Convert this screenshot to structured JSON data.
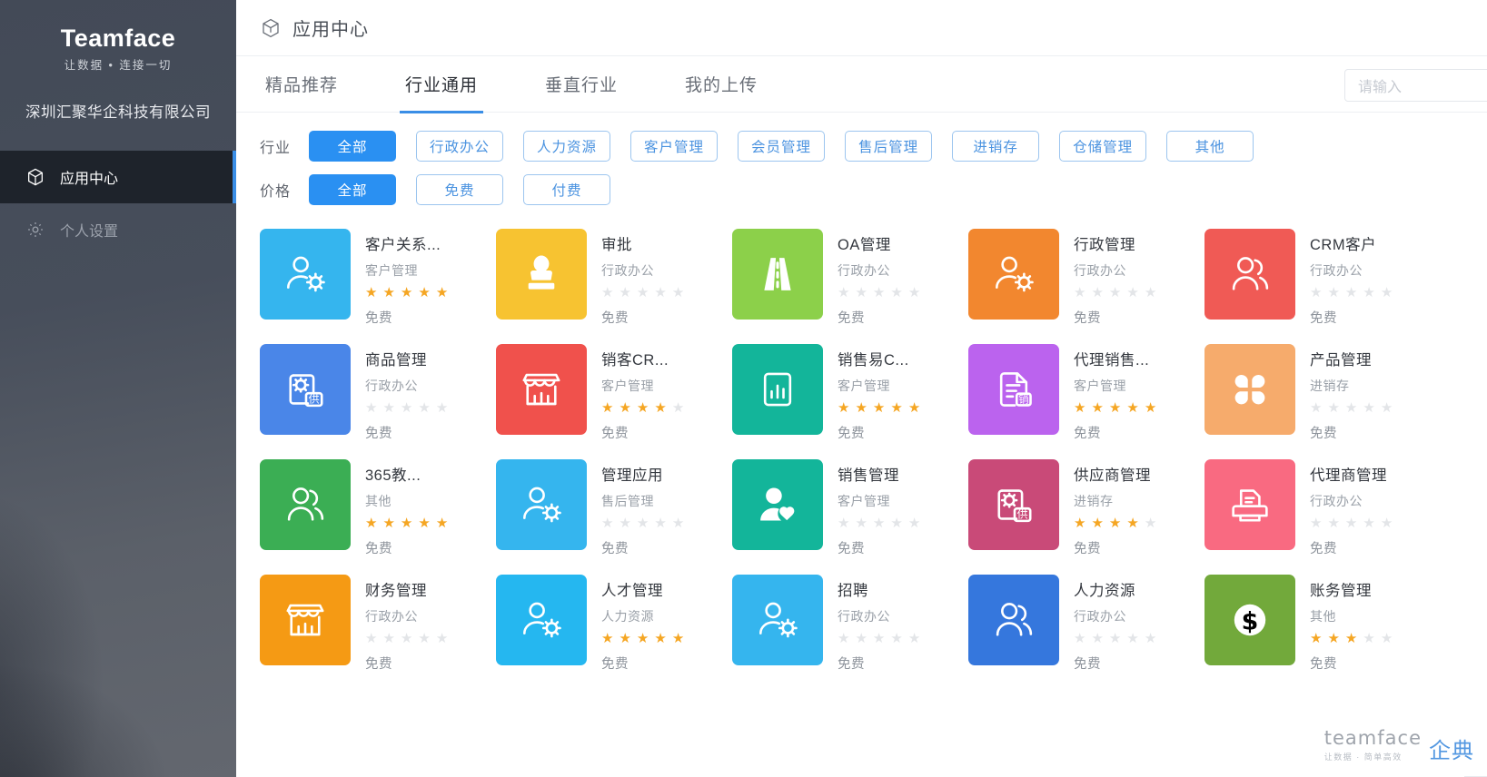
{
  "sidebar": {
    "logo": "Teamface",
    "slogan": "让数据 • 连接一切",
    "company": "深圳汇聚华企科技有限公司",
    "items": [
      {
        "label": "应用中心",
        "icon": "cube-icon",
        "active": true
      },
      {
        "label": "个人设置",
        "icon": "gear-icon",
        "active": false
      }
    ]
  },
  "header": {
    "title": "应用中心",
    "icon": "cube-icon"
  },
  "tabs": [
    {
      "label": "精品推荐",
      "active": false
    },
    {
      "label": "行业通用",
      "active": true
    },
    {
      "label": "垂直行业",
      "active": false
    },
    {
      "label": "我的上传",
      "active": false
    }
  ],
  "search": {
    "placeholder": "请输入",
    "value": ""
  },
  "filters": [
    {
      "label": "行业",
      "options": [
        {
          "label": "全部",
          "active": true
        },
        {
          "label": "行政办公",
          "active": false
        },
        {
          "label": "人力资源",
          "active": false
        },
        {
          "label": "客户管理",
          "active": false
        },
        {
          "label": "会员管理",
          "active": false
        },
        {
          "label": "售后管理",
          "active": false
        },
        {
          "label": "进销存",
          "active": false
        },
        {
          "label": "仓储管理",
          "active": false
        },
        {
          "label": "其他",
          "active": false
        }
      ]
    },
    {
      "label": "价格",
      "options": [
        {
          "label": "全部",
          "active": true
        },
        {
          "label": "免费",
          "active": false
        },
        {
          "label": "付费",
          "active": false
        }
      ]
    }
  ],
  "apps": [
    {
      "name": "客户关系...",
      "category": "客户管理",
      "stars": 5,
      "price": "免费",
      "color": "#35b5ee",
      "icon": "user-gear-icon"
    },
    {
      "name": "审批",
      "category": "行政办公",
      "stars": 0,
      "price": "免费",
      "color": "#f7c331",
      "icon": "stamp-icon"
    },
    {
      "name": "OA管理",
      "category": "行政办公",
      "stars": 0,
      "price": "免费",
      "color": "#8cd04a",
      "icon": "road-icon"
    },
    {
      "name": "行政管理",
      "category": "行政办公",
      "stars": 0,
      "price": "免费",
      "color": "#f2872f",
      "icon": "user-gear-icon"
    },
    {
      "name": "CRM客户",
      "category": "行政办公",
      "stars": 0,
      "price": "免费",
      "color": "#f05a55",
      "icon": "users-icon"
    },
    {
      "name": "商品管理",
      "category": "行政办公",
      "stars": 0,
      "price": "免费",
      "color": "#4a86e8",
      "icon": "supply-doc-icon"
    },
    {
      "name": "销客CR...",
      "category": "客户管理",
      "stars": 4,
      "price": "免费",
      "color": "#f0514c",
      "icon": "shop-icon"
    },
    {
      "name": "销售易C...",
      "category": "客户管理",
      "stars": 5,
      "price": "免费",
      "color": "#13b59a",
      "icon": "chart-doc-icon"
    },
    {
      "name": "代理销售...",
      "category": "客户管理",
      "stars": 5,
      "price": "免费",
      "color": "#bb63ee",
      "icon": "sales-doc-icon"
    },
    {
      "name": "产品管理",
      "category": "进销存",
      "stars": 0,
      "price": "免费",
      "color": "#f6ab6c",
      "icon": "clover-icon"
    },
    {
      "name": "365教...",
      "category": "其他",
      "stars": 5,
      "price": "免费",
      "color": "#3bae54",
      "icon": "users-icon"
    },
    {
      "name": "管理应用",
      "category": "售后管理",
      "stars": 0,
      "price": "免费",
      "color": "#35b5ee",
      "icon": "user-gear-icon"
    },
    {
      "name": "销售管理",
      "category": "客户管理",
      "stars": 0,
      "price": "免费",
      "color": "#13b59a",
      "icon": "user-heart-icon"
    },
    {
      "name": "供应商管理",
      "category": "进销存",
      "stars": 4,
      "price": "免费",
      "color": "#c94a78",
      "icon": "supply-doc-icon"
    },
    {
      "name": "代理商管理",
      "category": "行政办公",
      "stars": 0,
      "price": "免费",
      "color": "#f96a81",
      "icon": "printer-icon"
    },
    {
      "name": "财务管理",
      "category": "行政办公",
      "stars": 0,
      "price": "免费",
      "color": "#f59a14",
      "icon": "shop-icon"
    },
    {
      "name": "人才管理",
      "category": "人力资源",
      "stars": 5,
      "price": "免费",
      "color": "#25b7f0",
      "icon": "user-gear-icon"
    },
    {
      "name": "招聘",
      "category": "行政办公",
      "stars": 0,
      "price": "免费",
      "color": "#35b5ee",
      "icon": "user-gear-icon"
    },
    {
      "name": "人力资源",
      "category": "行政办公",
      "stars": 0,
      "price": "免费",
      "color": "#3577dd",
      "icon": "users-icon"
    },
    {
      "name": "账务管理",
      "category": "其他",
      "stars": 3,
      "price": "免费",
      "color": "#72a93b",
      "icon": "dollar-icon"
    }
  ],
  "watermark": {
    "name": "teamface",
    "tagline": "让数据 · 简单高效",
    "cn": "企典"
  },
  "colors": {
    "accent": "#3a8ee6",
    "chip_active": "#2a90f2",
    "star_on": "#f5a623",
    "star_off": "#e3e5e8"
  }
}
